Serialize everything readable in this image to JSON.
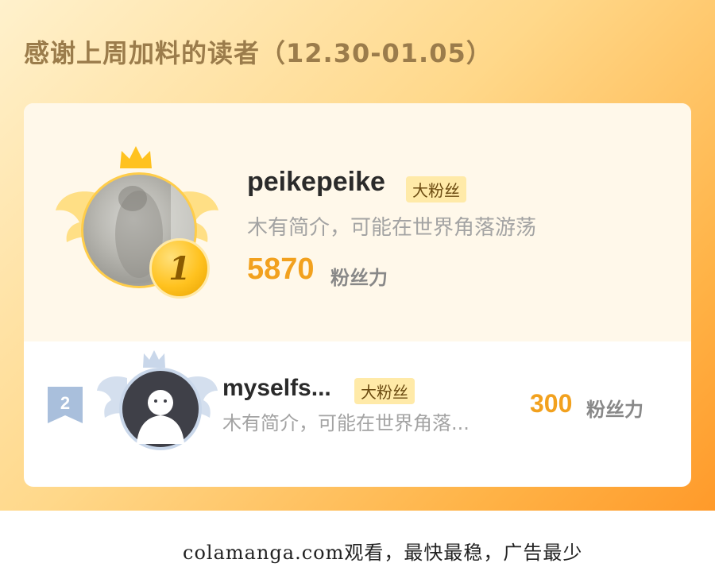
{
  "header": {
    "title": "感谢上周加料的读者（12.30-01.05）"
  },
  "colors": {
    "accent": "#f2a11e",
    "badge_bg": "#ffeaa8",
    "gold": "#ffc21f",
    "silver": "#c9d7ea"
  },
  "ranking": [
    {
      "rank": "1",
      "name": "peikepeike",
      "badge": "大粉丝",
      "bio": "木有简介，可能在世界角落游荡",
      "score": "5870",
      "unit": "粉丝力",
      "icons": [
        "crown-icon",
        "wing-icon",
        "medal-icon"
      ]
    },
    {
      "rank": "2",
      "name": "myselfs...",
      "badge": "大粉丝",
      "bio": "木有简介，可能在世界角落...",
      "score": "300",
      "unit": "粉丝力",
      "icons": [
        "crown-icon",
        "wing-icon",
        "ribbon-icon",
        "default-avatar-icon"
      ]
    }
  ],
  "footer": {
    "text": "colamanga.com观看，最快最稳，广告最少"
  }
}
